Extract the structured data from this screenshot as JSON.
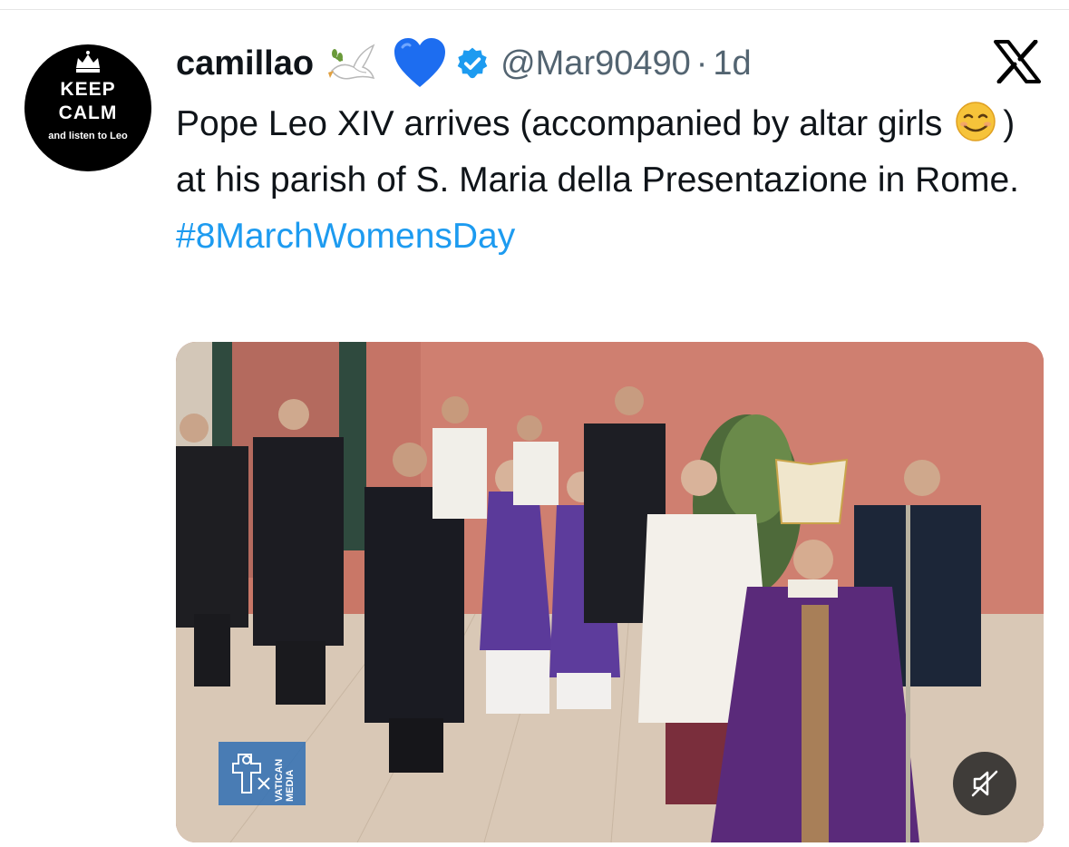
{
  "tweet": {
    "display_name": "camillao",
    "handle": "@Mar90490",
    "separator": "·",
    "time": "1d",
    "name_emojis": [
      "dove-icon",
      "blue-heart-icon"
    ],
    "verified": "verified-badge-icon",
    "platform_logo": "x-logo-icon",
    "text_part1": "Pope Leo XIV arrives (accompanied by altar girls ",
    "text_emoji": "smiling-face-icon",
    "text_part2": ") at his parish of S. Maria della Presentazione in Rome.",
    "hashtag": "#8MarchWomensDay"
  },
  "avatar": {
    "line1": "KEEP",
    "line2": "CALM",
    "line3": "and listen to Leo"
  },
  "media": {
    "watermark_text1": "VATICAN",
    "watermark_text2": "MEDIA",
    "mute_icon": "speaker-muted-icon"
  },
  "colors": {
    "link": "#1d9bf0",
    "verified": "#1d9bf0",
    "secondary_text": "#536471",
    "primary_text": "#0f1419",
    "heart": "#1d6df0"
  }
}
